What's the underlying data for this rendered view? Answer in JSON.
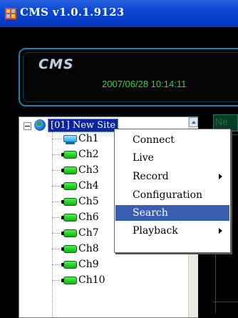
{
  "window": {
    "title": "CMS  v1.0.1.9123"
  },
  "header": {
    "logo": "CMS",
    "datetime": "2007/06/28 10:14:11"
  },
  "tree": {
    "root_label": "[01] New Site",
    "channels": [
      "Ch1",
      "Ch2",
      "Ch3",
      "Ch4",
      "Ch5",
      "Ch6",
      "Ch7",
      "Ch8",
      "Ch9",
      "Ch10"
    ]
  },
  "right_panel": {
    "header_text": "Ne"
  },
  "context_menu": {
    "items": [
      {
        "label": "Connect"
      },
      {
        "label": "Live"
      },
      {
        "label": "Record"
      },
      {
        "label": "Configuration"
      },
      {
        "label": "Search"
      },
      {
        "label": "Playback"
      }
    ],
    "highlighted": "Search"
  },
  "colors": {
    "titlebar": "#0a46d4",
    "datetime": "#36d33a",
    "selection": "#3a5fb0"
  },
  "icons": [
    "app-icon",
    "globe-icon",
    "camera-icon",
    "submenu-arrow-icon",
    "scroll-up-icon"
  ]
}
